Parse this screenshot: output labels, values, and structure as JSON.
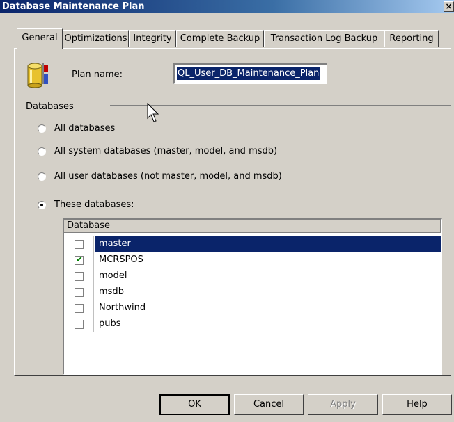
{
  "window": {
    "title": "Database Maintenance Plan",
    "close_glyph": "×"
  },
  "tabs": [
    {
      "label": "General",
      "active": true
    },
    {
      "label": "Optimizations"
    },
    {
      "label": "Integrity"
    },
    {
      "label": "Complete Backup"
    },
    {
      "label": "Transaction Log Backup"
    },
    {
      "label": "Reporting"
    }
  ],
  "plan": {
    "label": "Plan name:",
    "value": "QL_User_DB_Maintenance_Plan"
  },
  "databases_group": {
    "label": "Databases",
    "options": [
      {
        "label": "All databases",
        "selected": false
      },
      {
        "label": "All system databases (master, model, and msdb)",
        "selected": false
      },
      {
        "label": "All user databases (not master, model, and msdb)",
        "selected": false
      },
      {
        "label": "These databases:",
        "selected": true
      }
    ]
  },
  "grid": {
    "column_header": "Database",
    "rows": [
      {
        "name": "master",
        "checked": false,
        "selected": true
      },
      {
        "name": "MCRSPOS",
        "checked": true,
        "selected": false
      },
      {
        "name": "model",
        "checked": false,
        "selected": false
      },
      {
        "name": "msdb",
        "checked": false,
        "selected": false
      },
      {
        "name": "Northwind",
        "checked": false,
        "selected": false
      },
      {
        "name": "pubs",
        "checked": false,
        "selected": false
      }
    ]
  },
  "buttons": {
    "ok": "OK",
    "cancel": "Cancel",
    "apply": "Apply",
    "help": "Help"
  },
  "colors": {
    "selection": "#0a246a",
    "face": "#d4d0c8",
    "check": "#008000"
  }
}
